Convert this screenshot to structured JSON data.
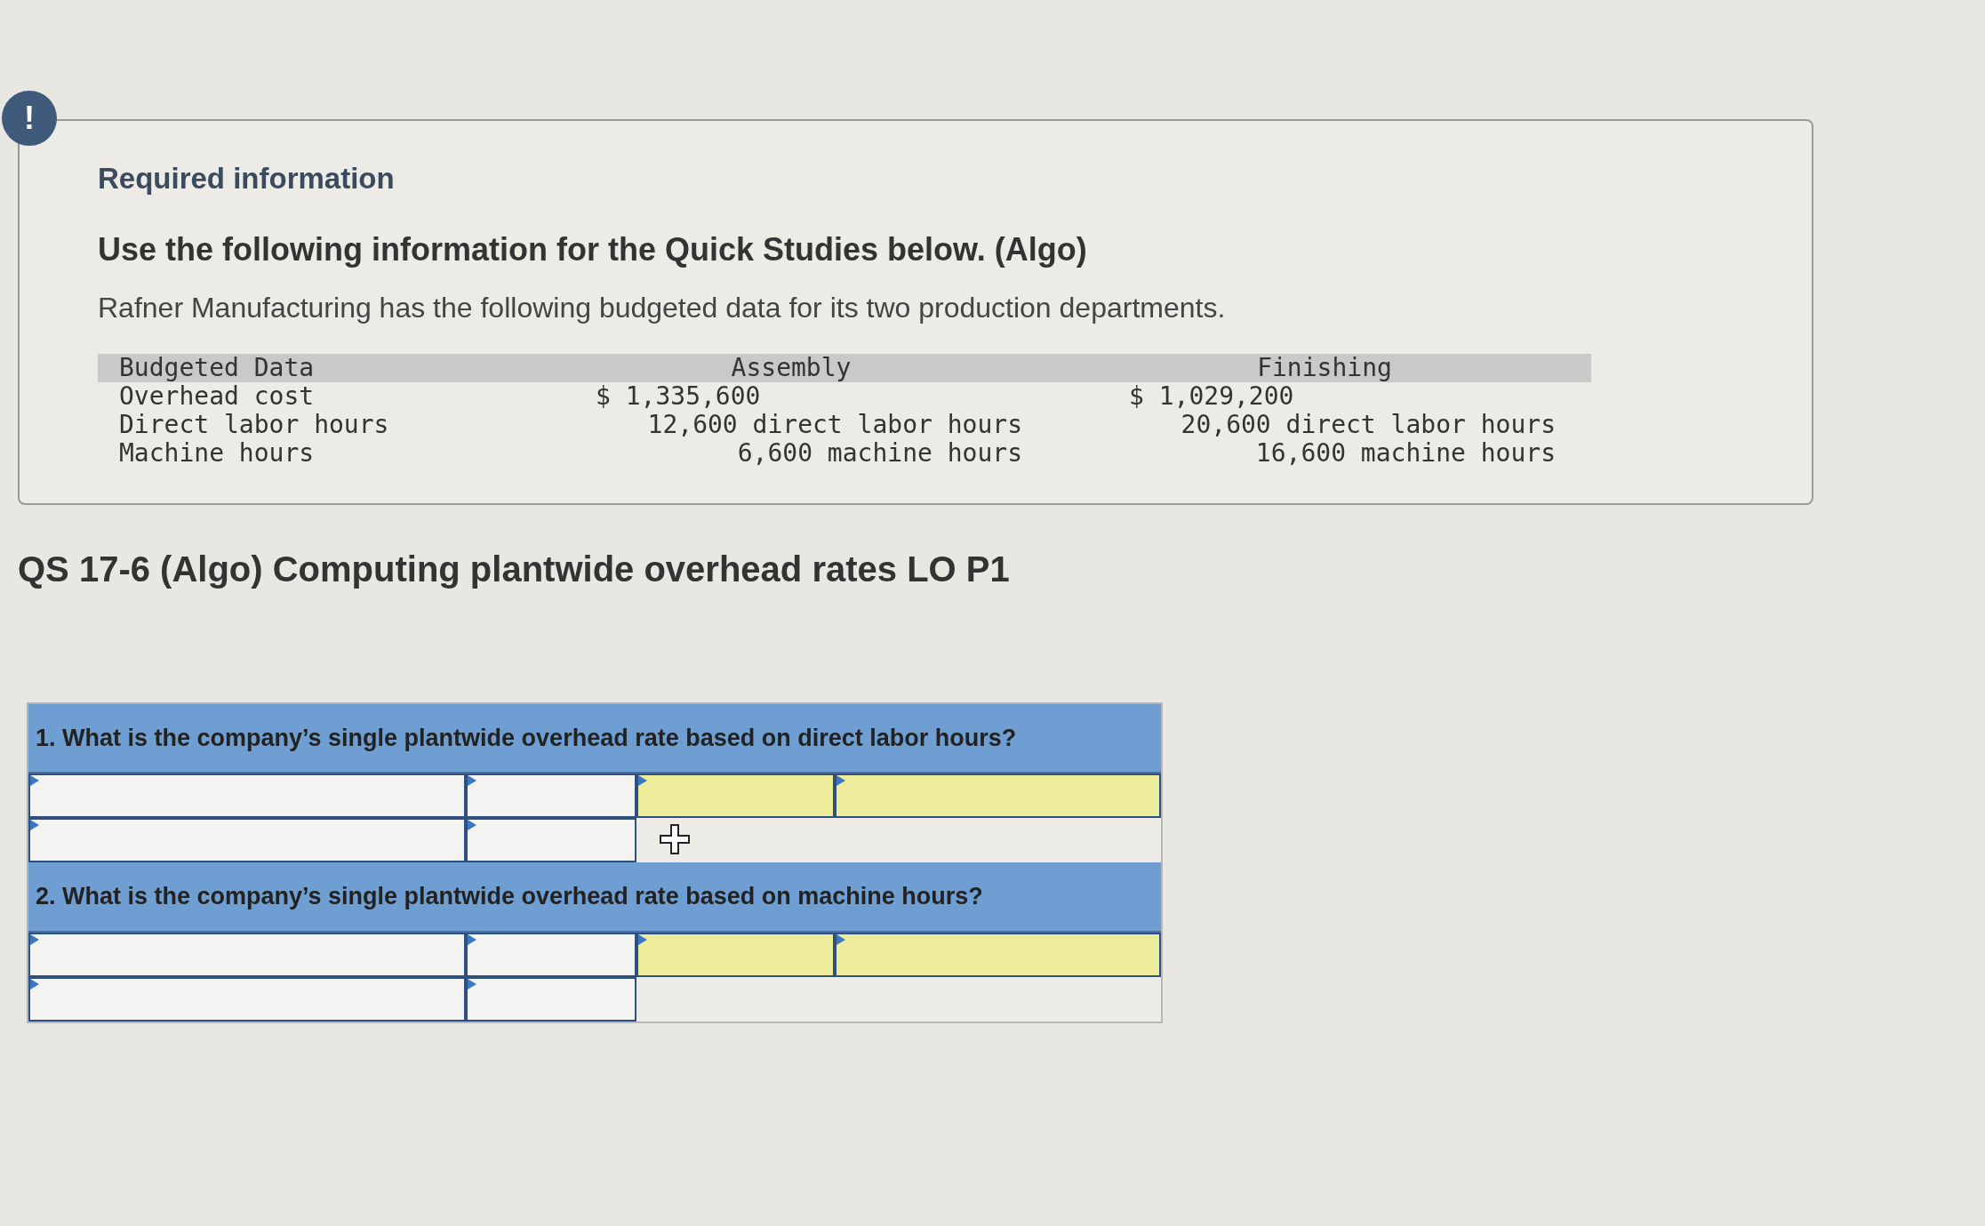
{
  "alert_icon": "!",
  "info": {
    "title": "Required information",
    "heading": "Use the following information for the Quick Studies below. (Algo)",
    "intro": "Rafner Manufacturing has the following budgeted data for its two production departments.",
    "table": {
      "columns": [
        "Budgeted Data",
        "Assembly",
        "Finishing"
      ],
      "rows": [
        {
          "kind": "amount",
          "cells": [
            "Overhead cost",
            "$ 1,335,600",
            "$ 1,029,200"
          ]
        },
        {
          "kind": "quantity",
          "cells": [
            "Direct labor hours",
            "12,600 direct labor hours",
            "20,600 direct labor hours"
          ]
        },
        {
          "kind": "quantity",
          "cells": [
            "Machine hours",
            "6,600 machine hours",
            "16,600 machine hours"
          ]
        }
      ]
    }
  },
  "exercise_title": "QS 17-6 (Algo) Computing plantwide overhead rates LO P1",
  "questions": [
    {
      "number": "1.",
      "text": "What is the company’s single plantwide overhead rate based on direct labor hours?",
      "rows": [
        {
          "cells": [
            {
              "kind": "input"
            },
            {
              "kind": "input"
            },
            {
              "kind": "answer"
            },
            {
              "kind": "answer"
            }
          ]
        },
        {
          "cells": [
            {
              "kind": "input"
            },
            {
              "kind": "input"
            },
            {
              "kind": "blank"
            }
          ]
        }
      ],
      "cursor": true
    },
    {
      "number": "2.",
      "text": "What is the company’s single plantwide overhead rate based on machine hours?",
      "rows": [
        {
          "cells": [
            {
              "kind": "input"
            },
            {
              "kind": "input"
            },
            {
              "kind": "answer"
            },
            {
              "kind": "answer"
            }
          ]
        },
        {
          "cells": [
            {
              "kind": "input"
            },
            {
              "kind": "input"
            },
            {
              "kind": "blank"
            }
          ]
        }
      ],
      "cursor": false
    }
  ]
}
